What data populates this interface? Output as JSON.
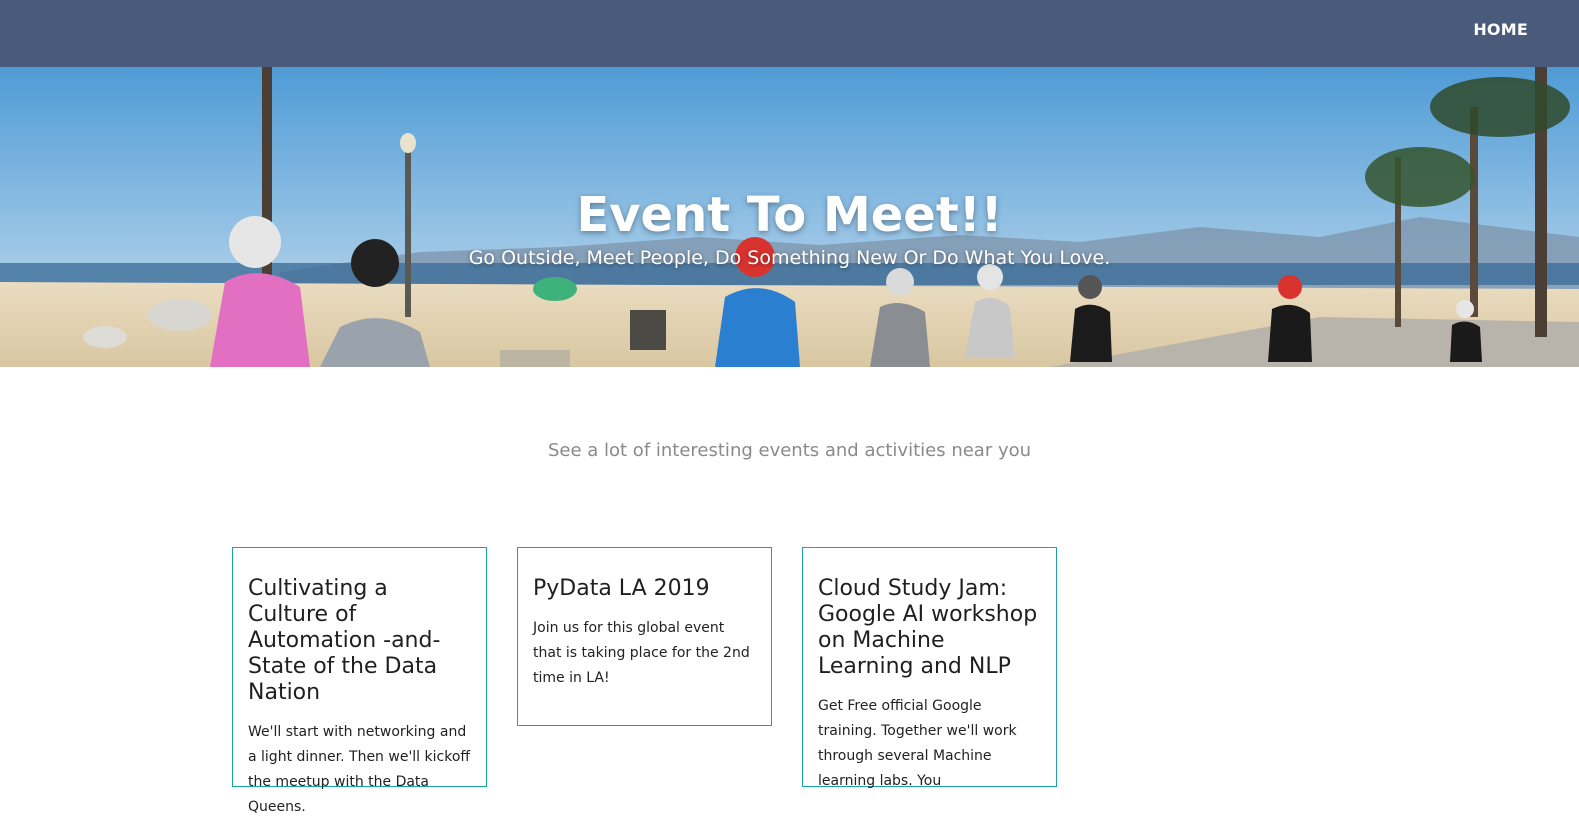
{
  "nav": {
    "home_label": "HOME"
  },
  "hero": {
    "title": "Event To Meet!!",
    "subtitle": "Go Outside, Meet People, Do Something New Or Do What You Love."
  },
  "tagline": "See a lot of interesting events and activities near you",
  "events": [
    {
      "title": "Cultivating a Culture of Automation -and- State of the Data Nation",
      "description": "We'll start with networking and a light dinner. Then we'll kickoff the meetup with the Data Queens."
    },
    {
      "title": "PyData LA 2019",
      "description": "Join us for this global event that is taking place for the 2nd time in LA!"
    },
    {
      "title": "Cloud Study Jam: Google AI workshop on Machine Learning and NLP",
      "description": "Get Free official Google training. Together we'll work through several Machine learning labs. You"
    }
  ],
  "colors": {
    "navbar": "#4a5a7a",
    "card_border": "#1ba3a8",
    "tagline": "#8a8a8a"
  }
}
